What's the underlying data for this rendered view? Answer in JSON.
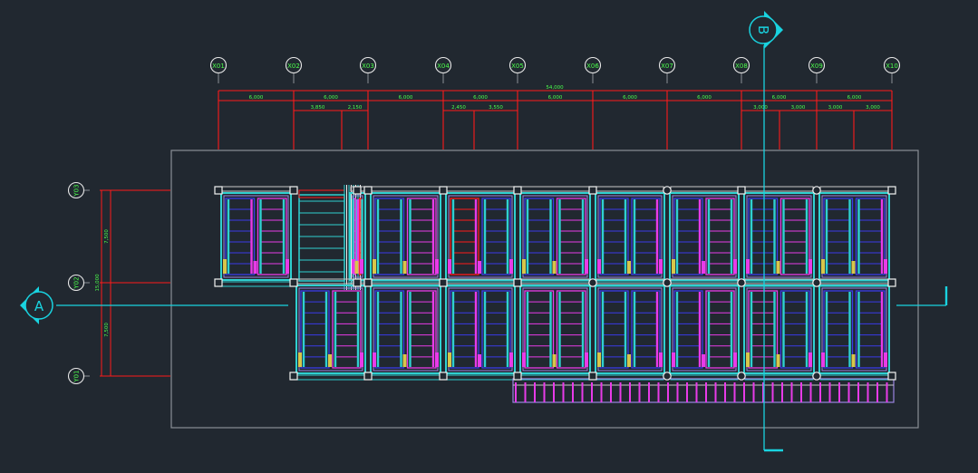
{
  "drawing": {
    "colors": {
      "background": "#212830",
      "grid_line": "#ff1a1a",
      "dimension_text": "#4cff4c",
      "section_marker": "#19d3e0",
      "frame": "#8a8f96",
      "beam_cyan": "#2fd0d0",
      "beam_magenta": "#e83be8",
      "beam_blue": "#3a3ae8",
      "beam_yellow": "#d8c64a",
      "beam_lavender": "#9c84e0",
      "beam_grey": "#c9c9c9",
      "beam_white": "#f2f2f2"
    },
    "column_axes": [
      "X01",
      "X02",
      "X03",
      "X04",
      "X05",
      "X06",
      "X07",
      "X08",
      "X09",
      "X10"
    ],
    "row_axes": [
      "Y03",
      "Y02",
      "Y01"
    ],
    "total_dimension": "54,000",
    "bay_dimensions": [
      "6,000",
      "6,000",
      "6,000",
      "6,000",
      "6,000",
      "6,000",
      "6,000",
      "6,000",
      "6,000"
    ],
    "sub_dimensions": [
      "3,850",
      "2,150",
      "2,450",
      "3,550",
      "3,000",
      "3,000",
      "3,000",
      "3,000"
    ],
    "row_dimensions": [
      "7,500",
      "7,500"
    ],
    "row_total_dimension": "15,000",
    "section_markers": {
      "horizontal": "A",
      "vertical": "B"
    }
  }
}
